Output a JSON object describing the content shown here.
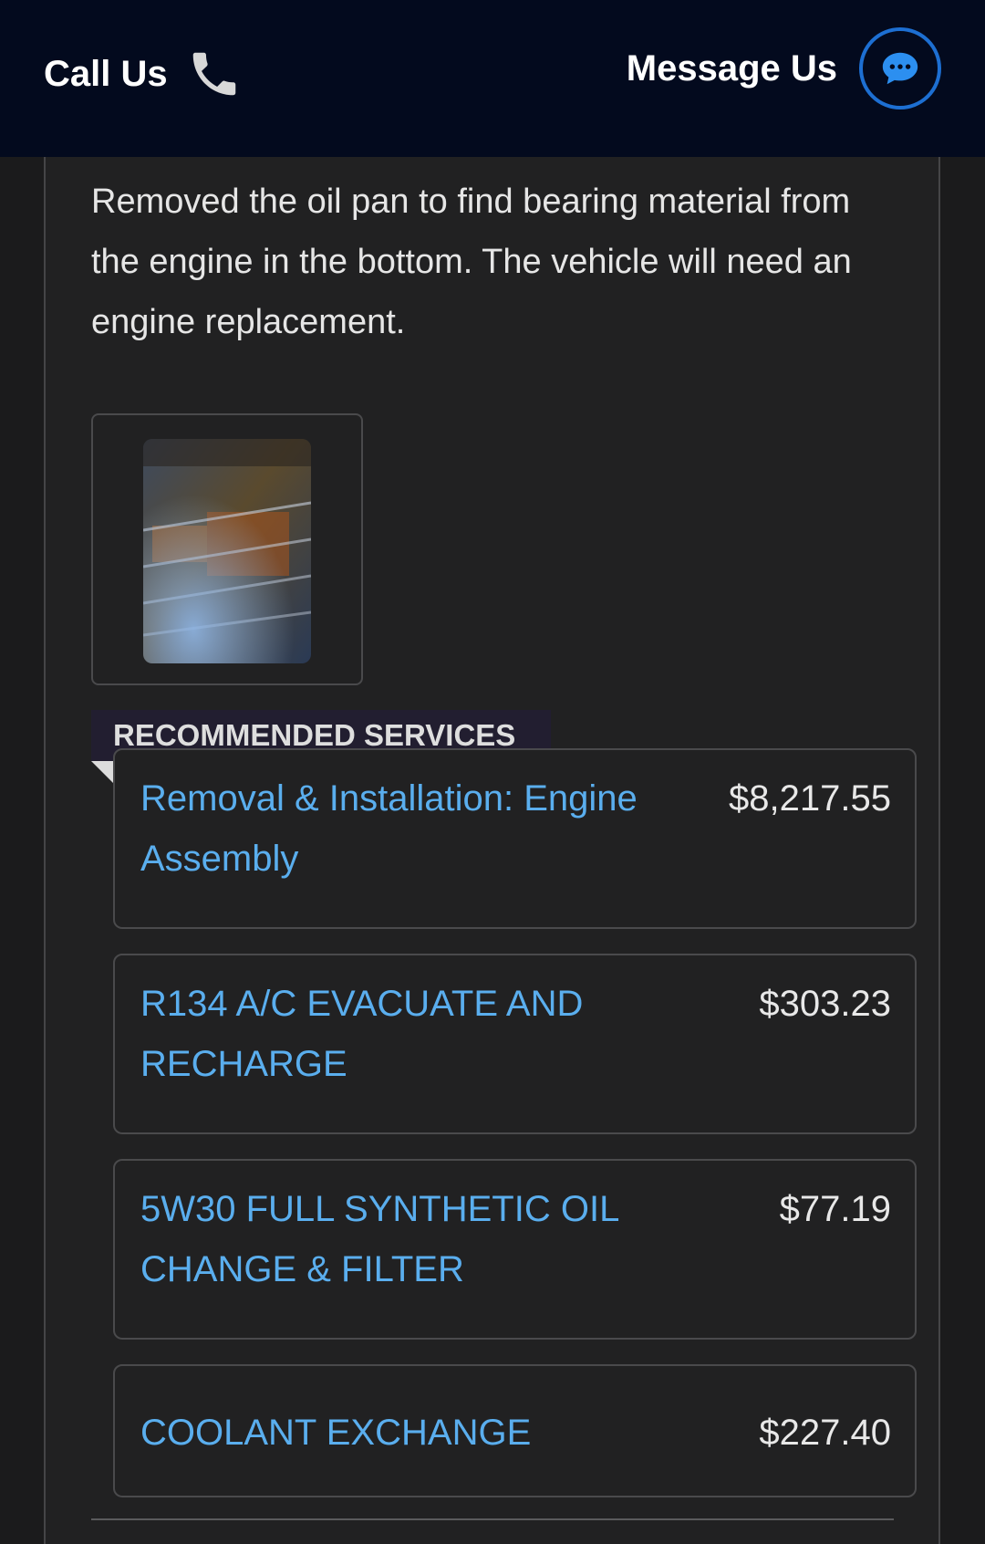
{
  "header": {
    "call_label": "Call Us",
    "message_label": "Message Us",
    "call_icon": "phone-icon",
    "message_icon": "chat-bubble-icon",
    "accent_color": "#1d6fd2",
    "background_color": "#030a1e"
  },
  "inspection": {
    "description": "Removed the oil pan to find bearing material from the engine in the bottom. The vehicle will need an engine replacement."
  },
  "recommended": {
    "heading": "RECOMMENDED SERVICES",
    "services": [
      {
        "name": "Removal & Installation: Engine Assembly",
        "price": "$8,217.55"
      },
      {
        "name": "R134 A/C EVACUATE AND RECHARGE",
        "price": "$303.23"
      },
      {
        "name": "5W30 FULL SYNTHETIC OIL CHANGE & FILTER",
        "price": "$77.19"
      },
      {
        "name": "COOLANT EXCHANGE",
        "price": "$227.40"
      }
    ]
  },
  "colors": {
    "link": "#5aaeee",
    "page_background": "#1b1b1c",
    "card_background": "#212122"
  }
}
